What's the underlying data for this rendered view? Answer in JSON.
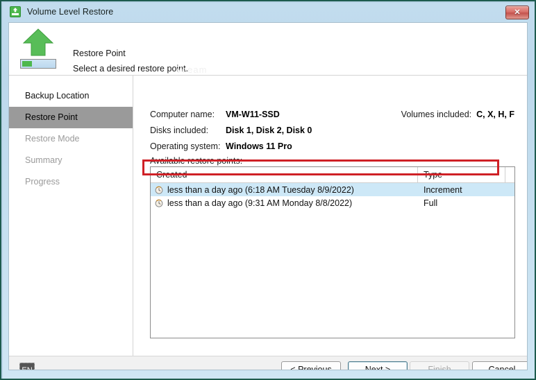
{
  "window": {
    "title": "Volume Level Restore",
    "title_icon": "restore-upload-icon",
    "close_label": "✕"
  },
  "banner": {
    "icon": "green-up-arrow-icon",
    "title": "Restore Point",
    "subtitle": "Select a desired restore point.",
    "watermark": "Veeam"
  },
  "sidebar": {
    "items": [
      {
        "label": "Backup Location",
        "state": "available"
      },
      {
        "label": "Restore Point",
        "state": "selected"
      },
      {
        "label": "Restore Mode",
        "state": "disabled"
      },
      {
        "label": "Summary",
        "state": "disabled"
      },
      {
        "label": "Progress",
        "state": "disabled"
      }
    ]
  },
  "main": {
    "computer_name_label": "Computer name:",
    "computer_name_value": "VM-W11-SSD",
    "disks_label": "Disks included:",
    "disks_value": "Disk 1, Disk 2, Disk 0",
    "os_label": "Operating system:",
    "os_value": "Windows 11 Pro",
    "volumes_label": "Volumes included:",
    "volumes_value": "C, X, H, F",
    "available_label": "Available restore points:",
    "table": {
      "columns": [
        "Created",
        "Type"
      ],
      "rows": [
        {
          "icon": "clock-history-icon",
          "created": "less than a day ago (6:18 AM Tuesday 8/9/2022)",
          "type": "Increment",
          "selected": true
        },
        {
          "icon": "clock-history-icon",
          "created": "less than a day ago (9:31 AM Monday 8/8/2022)",
          "type": "Full",
          "selected": false
        }
      ]
    }
  },
  "footer": {
    "language": "EN",
    "previous_label": "< Previous",
    "next_label": "Next >",
    "finish_label": "Finish",
    "cancel_label": "Cancel"
  },
  "colors": {
    "accent_green": "#4db84d",
    "highlight_red": "#cf2026",
    "selection_blue": "#cde8f7",
    "titlebar_blue": "#c2dcee",
    "frame_green": "#1d5b4e"
  }
}
